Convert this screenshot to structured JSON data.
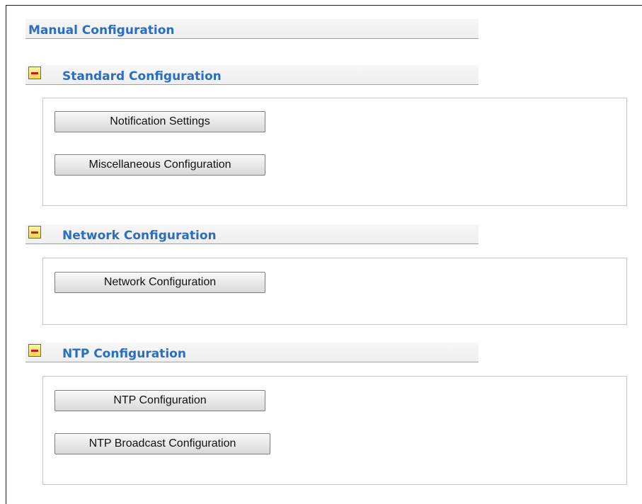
{
  "page": {
    "title": "Manual Configuration"
  },
  "sections": [
    {
      "title": "Standard Configuration",
      "buttons": [
        "Notification Settings",
        "Miscellaneous Configuration"
      ]
    },
    {
      "title": "Network Configuration",
      "buttons": [
        "Network Configuration"
      ]
    },
    {
      "title": "NTP Configuration",
      "buttons": [
        "NTP Configuration",
        "NTP Broadcast Configuration"
      ]
    }
  ],
  "icons": {
    "collapse": "minus-icon"
  },
  "colors": {
    "heading": "#2a6ebd",
    "icon_fill": "#f2d64a",
    "icon_minus": "#d4141c"
  }
}
